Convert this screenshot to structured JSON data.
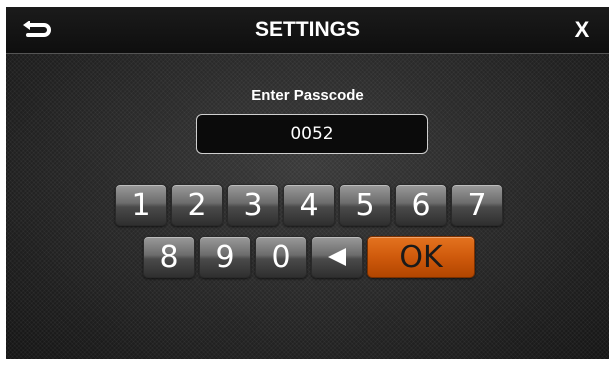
{
  "header": {
    "title": "SETTINGS",
    "back_icon": "back-arrow-icon",
    "close_label": "X"
  },
  "passcode": {
    "prompt": "Enter Passcode",
    "value": "0052"
  },
  "keypad": {
    "row1": [
      "1",
      "2",
      "3",
      "4",
      "5",
      "6",
      "7"
    ],
    "row2": [
      "8",
      "9",
      "0"
    ],
    "backspace_icon": "backspace-triangle-icon",
    "ok_label": "OK"
  },
  "colors": {
    "ok_button": "#cf5a0c",
    "key_button": "#6c6c6c",
    "background": "#262626"
  }
}
